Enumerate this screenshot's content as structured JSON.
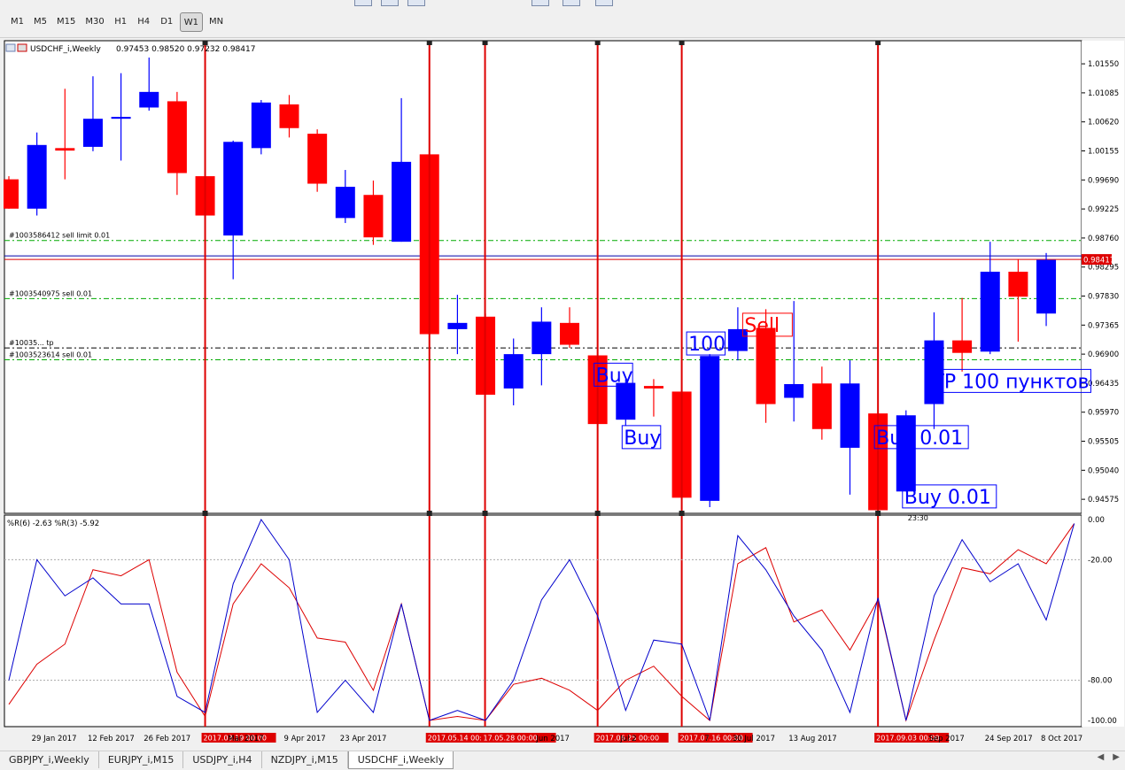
{
  "timeframes": [
    {
      "label": "M1",
      "active": false
    },
    {
      "label": "M5",
      "active": false
    },
    {
      "label": "M15",
      "active": false
    },
    {
      "label": "M30",
      "active": false
    },
    {
      "label": "H1",
      "active": false
    },
    {
      "label": "H4",
      "active": false
    },
    {
      "label": "D1",
      "active": false
    },
    {
      "label": "W1",
      "active": true
    },
    {
      "label": "MN",
      "active": false
    }
  ],
  "chart_header": {
    "symbol_label": "USDCHF_i,Weekly",
    "ohlc": "0.97453 0.98520 0.97232 0.98417"
  },
  "indicator_label": "%R(6) -2.63 %R(3) -5.92",
  "chart_data": {
    "type": "candlestick",
    "colors": {
      "up": "#0000ff",
      "down": "#ff0000"
    },
    "price_axis": {
      "min": 0.9435,
      "max": 1.0192,
      "ticks": [
        "1.01550",
        "1.01085",
        "1.00620",
        "1.00155",
        "0.99690",
        "0.99225",
        "0.98760",
        "0.98295",
        "0.97830",
        "0.97365",
        "0.96900",
        "0.96435",
        "0.95970",
        "0.95505",
        "0.95040",
        "0.94575"
      ]
    },
    "current_price": "0.98417",
    "candles": [
      {
        "o": 0.997,
        "h": 0.9975,
        "l": 0.9923,
        "c": 0.9923
      },
      {
        "o": 0.9923,
        "h": 1.0045,
        "l": 0.9912,
        "c": 1.0025
      },
      {
        "o": 1.002,
        "h": 1.0115,
        "l": 0.997,
        "c": 1.0016
      },
      {
        "o": 1.0022,
        "h": 1.0135,
        "l": 1.0015,
        "c": 1.0067
      },
      {
        "o": 1.0067,
        "h": 1.014,
        "l": 1.0,
        "c": 1.007
      },
      {
        "o": 1.0085,
        "h": 1.0165,
        "l": 1.008,
        "c": 1.011
      },
      {
        "o": 1.0095,
        "h": 1.011,
        "l": 0.9945,
        "c": 0.998
      },
      {
        "o": 0.9975,
        "h": 0.9988,
        "l": 0.9905,
        "c": 0.9912
      },
      {
        "o": 0.988,
        "h": 1.0032,
        "l": 0.981,
        "c": 1.003
      },
      {
        "o": 1.002,
        "h": 1.0097,
        "l": 1.001,
        "c": 1.0093
      },
      {
        "o": 1.009,
        "h": 1.0105,
        "l": 1.0037,
        "c": 1.0052
      },
      {
        "o": 1.0043,
        "h": 1.005,
        "l": 0.995,
        "c": 0.9963
      },
      {
        "o": 0.9908,
        "h": 0.9985,
        "l": 0.99,
        "c": 0.9958
      },
      {
        "o": 0.9945,
        "h": 0.9968,
        "l": 0.9865,
        "c": 0.9877
      },
      {
        "o": 0.987,
        "h": 1.01,
        "l": 0.987,
        "c": 0.9998
      },
      {
        "o": 1.001,
        "h": 1.001,
        "l": 0.972,
        "c": 0.9722
      },
      {
        "o": 0.973,
        "h": 0.9785,
        "l": 0.969,
        "c": 0.974
      },
      {
        "o": 0.975,
        "h": 0.9755,
        "l": 0.9625,
        "c": 0.9625
      },
      {
        "o": 0.9635,
        "h": 0.9715,
        "l": 0.9608,
        "c": 0.969
      },
      {
        "o": 0.969,
        "h": 0.9765,
        "l": 0.964,
        "c": 0.9742
      },
      {
        "o": 0.974,
        "h": 0.9765,
        "l": 0.97,
        "c": 0.9705
      },
      {
        "o": 0.9688,
        "h": 0.969,
        "l": 0.957,
        "c": 0.9578
      },
      {
        "o": 0.9585,
        "h": 0.965,
        "l": 0.9575,
        "c": 0.9644
      },
      {
        "o": 0.9639,
        "h": 0.965,
        "l": 0.959,
        "c": 0.9635
      },
      {
        "o": 0.963,
        "h": 0.965,
        "l": 0.9455,
        "c": 0.946
      },
      {
        "o": 0.9455,
        "h": 0.969,
        "l": 0.9445,
        "c": 0.9687
      },
      {
        "o": 0.9695,
        "h": 0.9765,
        "l": 0.968,
        "c": 0.973
      },
      {
        "o": 0.9732,
        "h": 0.9762,
        "l": 0.958,
        "c": 0.961
      },
      {
        "o": 0.962,
        "h": 0.9775,
        "l": 0.9582,
        "c": 0.9642
      },
      {
        "o": 0.9643,
        "h": 0.967,
        "l": 0.9553,
        "c": 0.957
      },
      {
        "o": 0.954,
        "h": 0.968,
        "l": 0.9465,
        "c": 0.9643
      },
      {
        "o": 0.9595,
        "h": 0.9598,
        "l": 0.9438,
        "c": 0.944
      },
      {
        "o": 0.947,
        "h": 0.96,
        "l": 0.947,
        "c": 0.9592
      },
      {
        "o": 0.961,
        "h": 0.9757,
        "l": 0.957,
        "c": 0.9712
      },
      {
        "o": 0.9712,
        "h": 0.978,
        "l": 0.9662,
        "c": 0.9692
      },
      {
        "o": 0.9694,
        "h": 0.987,
        "l": 0.969,
        "c": 0.9822
      },
      {
        "o": 0.9822,
        "h": 0.9842,
        "l": 0.971,
        "c": 0.9782
      },
      {
        "o": 0.9755,
        "h": 0.9852,
        "l": 0.9735,
        "c": 0.9841
      }
    ],
    "x_ticks": [
      {
        "i": 1,
        "label": "29 Jan 2017"
      },
      {
        "i": 3,
        "label": "12 Feb 2017"
      },
      {
        "i": 5,
        "label": "26 Feb 2017"
      },
      {
        "i": 8,
        "label": "Mar 2017"
      },
      {
        "i": 10,
        "label": "9 Apr 2017"
      },
      {
        "i": 12,
        "label": "23 Apr 2017"
      },
      {
        "i": 19,
        "label": "Jun 2017"
      },
      {
        "i": 22,
        "label": "Jul 2"
      },
      {
        "i": 25,
        "label": "7"
      },
      {
        "i": 26,
        "label": "30 Jul 2017"
      },
      {
        "i": 28,
        "label": "13 Aug 2017"
      },
      {
        "i": 33,
        "label": "Sep 2017"
      },
      {
        "i": 35,
        "label": "24 Sep 2017"
      },
      {
        "i": 37,
        "label": "8 Oct 2017"
      }
    ],
    "vlines": [
      {
        "i": 7,
        "label": "2017.03.19 00:00"
      },
      {
        "i": 15,
        "label": "2017.05.14 00:00"
      },
      {
        "i": 17,
        "label": "17.05.28 00:00"
      },
      {
        "i": 21,
        "label": "2017.06.25 00:00"
      },
      {
        "i": 24,
        "label": "2017.07.16 00:00"
      },
      {
        "i": 31,
        "label": "2017.09.03 00:00"
      }
    ],
    "order_lines": [
      {
        "price": 0.9872,
        "label": "#1003586412 sell limit 0.01",
        "color": "#00aa00"
      },
      {
        "price": 0.9779,
        "label": "#1003540975 sell 0.01",
        "color": "#00aa00"
      },
      {
        "price": 0.97,
        "label": "#10035... tp",
        "color": "#000000"
      },
      {
        "price": 0.9681,
        "label": "#1003523614 sell 0.01",
        "color": "#00aa00"
      }
    ],
    "trade_labels": [
      {
        "text": "Buy",
        "price": 0.965,
        "i": 21.0,
        "color": "#0000ff"
      },
      {
        "text": "100",
        "price": 0.97,
        "i": 24.3,
        "color": "#0000ff"
      },
      {
        "text": "Buy",
        "price": 0.955,
        "i": 22.0,
        "color": "#0000ff"
      },
      {
        "text": "Sell",
        "price": 0.973,
        "i": 26.3,
        "color": "#ff0000"
      },
      {
        "text": "TP 100 пунктов",
        "price": 0.964,
        "i": 33.0,
        "color": "#0000ff"
      },
      {
        "text": "Buy 0.01",
        "price": 0.955,
        "i": 31.0,
        "color": "#0000ff"
      },
      {
        "text": "Buy 0.01",
        "price": 0.9455,
        "i": 32.0,
        "color": "#0000ff"
      }
    ],
    "small_label": "23:30",
    "wpr": {
      "axis_ticks": [
        "0.00",
        "-20.00",
        "-80.00",
        "-100.00"
      ],
      "r6": [
        -80,
        -20,
        -38,
        -29,
        -42,
        -42,
        -88,
        -96,
        -32,
        0,
        -20,
        -96,
        -80,
        -96,
        -42,
        -100,
        -95,
        -100,
        -80,
        -40,
        -20,
        -48,
        -95,
        -60,
        -62,
        -100,
        -8,
        -25,
        -48,
        -65,
        -96,
        -39,
        -100,
        -38,
        -10,
        -31,
        -22,
        -50,
        -2
      ],
      "r3": [
        -92,
        -72,
        -62,
        -25,
        -28,
        -20,
        -76,
        -98,
        -42,
        -22,
        -34,
        -59,
        -61,
        -85,
        -42,
        -100,
        -98,
        -100,
        -82,
        -79,
        -85,
        -95,
        -80,
        -73,
        -88,
        -100,
        -22,
        -14,
        -51,
        -45,
        -65,
        -40,
        -100,
        -60,
        -24,
        -27,
        -15,
        -22,
        -2
      ]
    }
  },
  "tabs": [
    {
      "label": "GBPJPY_i,Weekly",
      "active": false
    },
    {
      "label": "EURJPY_i,M15",
      "active": false
    },
    {
      "label": "USDJPY_i,H4",
      "active": false
    },
    {
      "label": "NZDJPY_i,M15",
      "active": false
    },
    {
      "label": "USDCHF_i,Weekly",
      "active": true
    }
  ],
  "tab_nav": {
    "left": "◀",
    "right": "▶"
  }
}
